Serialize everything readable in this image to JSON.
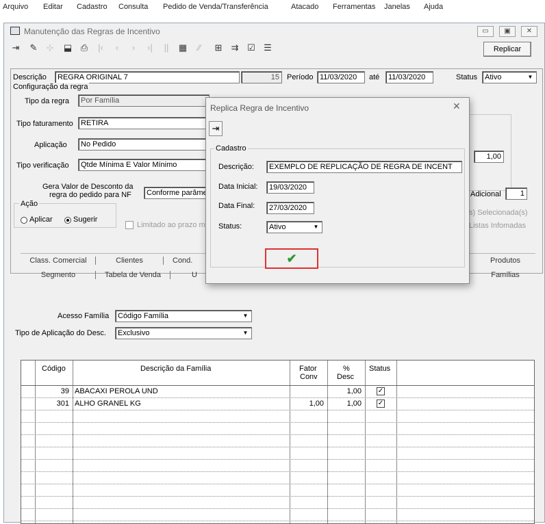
{
  "menu": [
    "Arquivo",
    "Editar",
    "Cadastro",
    "Consulta",
    "Pedido de Venda/Transferência",
    "Atacado",
    "Ferramentas",
    "Janelas",
    "Ajuda"
  ],
  "window": {
    "title": "Manutenção das Regras de Incentivo",
    "replicar_label": "Replicar"
  },
  "form": {
    "descricao_label": "Descrição",
    "descricao_value": "REGRA ORIGINAL 7",
    "numero": "15",
    "periodo_label": "Período",
    "periodo_inicio": "11/03/2020",
    "ate_label": "até",
    "periodo_fim": "11/03/2020",
    "status_label": "Status",
    "status_value": "Ativo",
    "config_group": "Configuração da regra",
    "tipo_regra_label": "Tipo da regra",
    "tipo_regra_value": "Por Família",
    "tipo_fat_label": "Tipo faturamento",
    "tipo_fat_value": "RETIRA",
    "aplicacao_label": "Aplicação",
    "aplicacao_value": "No Pedido",
    "tipo_verif_label": "Tipo verificação",
    "tipo_verif_value": "Qtde Mínima E Valor Mínimo",
    "gera_valor_label1": "Gera Valor de Desconto da",
    "gera_valor_label2": "regra do pedido para NF",
    "gera_valor_value": "Conforme parâme",
    "acao_group": "Ação",
    "aplicar_label": "Aplicar",
    "sugerir_label": "Sugerir",
    "limitado_label": "Limitado ao prazo m",
    "valor_right": "1,00",
    "adicional_label": "Adicional",
    "adicional_value": "1",
    "selecionadas_label": "s) Selecionada(s)",
    "listas_label": "Listas Infomadas"
  },
  "tabs_row1": [
    "Class. Comercial",
    "Clientes",
    "Cond.",
    "Produtos"
  ],
  "tabs_row2": [
    "Segmento",
    "Tabela de Venda",
    "U",
    "Famílias"
  ],
  "familia": {
    "acesso_label": "Acesso Família",
    "acesso_value": "Código Família",
    "tipo_aplic_label": "Tipo de Aplicação do Desc.",
    "tipo_aplic_value": "Exclusivo"
  },
  "grid": {
    "headers": {
      "codigo": "Código",
      "descricao": "Descrição da Família",
      "fator1": "Fator",
      "fator2": "Conv",
      "desc1": "%",
      "desc2": "Desc",
      "status": "Status"
    },
    "rows": [
      {
        "codigo": "39",
        "descricao": "ABACAXI PEROLA UND",
        "fator": "",
        "desc": "1,00",
        "checked": true
      },
      {
        "codigo": "301",
        "descricao": "ALHO GRANEL KG",
        "fator": "1,00",
        "desc": "1,00",
        "checked": true
      }
    ]
  },
  "dialog": {
    "title": "Replica Regra de Incentivo",
    "group": "Cadastro",
    "descricao_label": "Descrição:",
    "descricao_value": "EXEMPLO DE REPLICAÇÃO DE REGRA DE INCENT",
    "data_inicial_label": "Data Inicial:",
    "data_inicial_value": "19/03/2020",
    "data_final_label": "Data Final:",
    "data_final_value": "27/03/2020",
    "status_label": "Status:",
    "status_value": "Ativo",
    "confirm_highlight_color": "#e03030",
    "check_color": "#2e9a2e"
  }
}
